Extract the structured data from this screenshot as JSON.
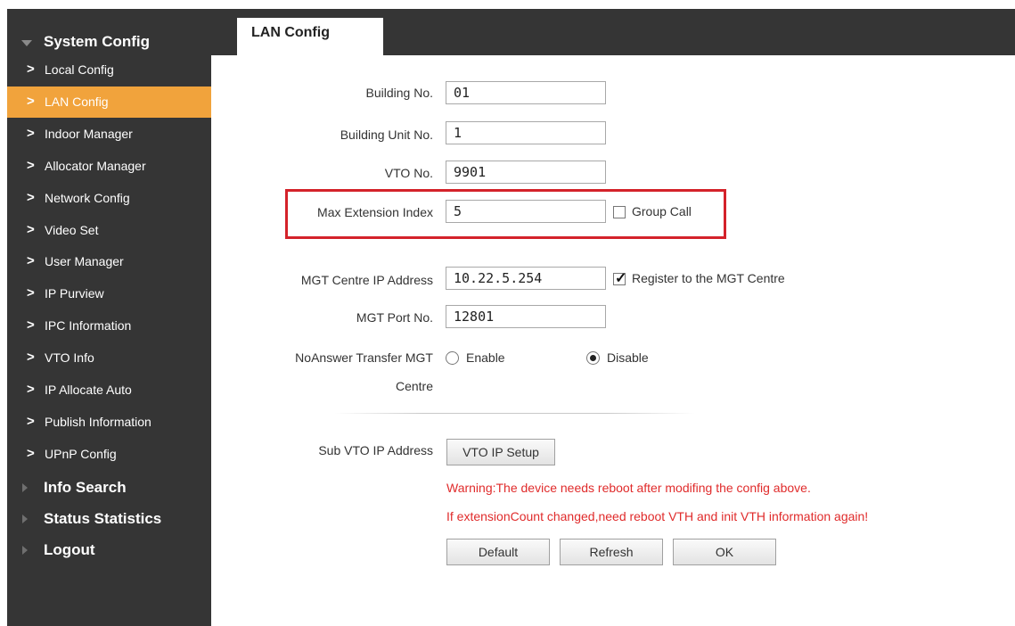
{
  "sidebar": {
    "system_config": "System Config",
    "items": [
      {
        "label": "Local Config"
      },
      {
        "label": "LAN Config"
      },
      {
        "label": "Indoor Manager"
      },
      {
        "label": "Allocator Manager"
      },
      {
        "label": "Network Config"
      },
      {
        "label": "Video Set"
      },
      {
        "label": "User Manager"
      },
      {
        "label": "IP Purview"
      },
      {
        "label": "IPC Information"
      },
      {
        "label": "VTO Info"
      },
      {
        "label": "IP Allocate Auto"
      },
      {
        "label": "Publish Information"
      },
      {
        "label": "UPnP Config"
      }
    ],
    "chevron": ">",
    "info_search": "Info Search",
    "status_statistics": "Status Statistics",
    "logout": "Logout"
  },
  "tab": {
    "title": "LAN Config"
  },
  "form": {
    "building_no": {
      "label": "Building No.",
      "value": "01"
    },
    "building_unit_no": {
      "label": "Building Unit No.",
      "value": "1"
    },
    "vto_no": {
      "label": "VTO No.",
      "value": "9901"
    },
    "max_extension_index": {
      "label": "Max Extension Index",
      "value": "5"
    },
    "group_call": {
      "label": "Group Call",
      "checked": false
    },
    "mgt_centre_ip": {
      "label": "MGT Centre IP Address",
      "value": "10.22.5.254"
    },
    "register_mgt": {
      "label": "Register to the MGT Centre",
      "checked": true,
      "check_glyph": "✓"
    },
    "mgt_port": {
      "label": "MGT Port No.",
      "value": "12801"
    },
    "noanswer_transfer": {
      "label_line1": "NoAnswer Transfer MGT",
      "label_line2": "Centre",
      "enable": "Enable",
      "disable": "Disable",
      "selected": "Disable"
    },
    "sub_vto_ip": {
      "label": "Sub VTO IP Address",
      "button": "VTO IP Setup"
    }
  },
  "warnings": {
    "line1": "Warning:The device needs reboot after modifing the config above.",
    "line2": "If extensionCount changed,need reboot VTH and init VTH information again!"
  },
  "buttons": {
    "default": "Default",
    "refresh": "Refresh",
    "ok": "OK"
  },
  "colors": {
    "sidebar_bg": "#353535",
    "active": "#f1a33c",
    "warning": "#e02b2b",
    "highlight": "#d4222a"
  }
}
